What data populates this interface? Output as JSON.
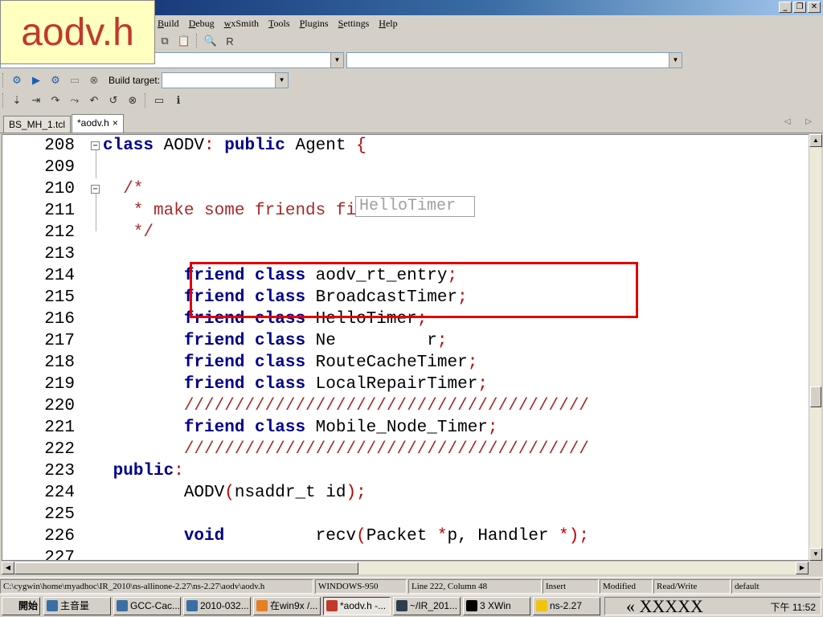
{
  "overlay": {
    "filename_label": "aodv.h"
  },
  "window": {
    "min_glyph": "_",
    "restore_glyph": "❐",
    "close_glyph": "✕"
  },
  "menu": [
    {
      "label": "Build",
      "accel": "B"
    },
    {
      "label": "Debug",
      "accel": "D"
    },
    {
      "label": "wxSmith",
      "accel": "w"
    },
    {
      "label": "Tools",
      "accel": "T"
    },
    {
      "label": "Plugins",
      "accel": "P"
    },
    {
      "label": "Settings",
      "accel": "S"
    },
    {
      "label": "Help",
      "accel": "H"
    }
  ],
  "toolbar": {
    "build_target_label": "Build target:"
  },
  "tabs": [
    {
      "label": "BS_MH_1.tcl",
      "active": false
    },
    {
      "label": "*aodv.h",
      "active": true,
      "close": "×"
    }
  ],
  "tab_nav": "◁ ▷",
  "code": [
    {
      "n": "208",
      "tokens": [
        [
          "kw",
          "class"
        ],
        [
          "id",
          " AODV"
        ],
        [
          "op",
          ":"
        ],
        [
          "id",
          " "
        ],
        [
          "kw",
          "public"
        ],
        [
          "id",
          " Agent "
        ],
        [
          "op",
          "{"
        ]
      ]
    },
    {
      "n": "209",
      "tokens": []
    },
    {
      "n": "210",
      "tokens": [
        [
          "cm",
          "  /*"
        ]
      ]
    },
    {
      "n": "211",
      "tokens": [
        [
          "cm",
          "   * make some friends first"
        ]
      ]
    },
    {
      "n": "212",
      "tokens": [
        [
          "cm",
          "   */"
        ]
      ]
    },
    {
      "n": "213",
      "tokens": []
    },
    {
      "n": "214",
      "tokens": [
        [
          "id",
          "        "
        ],
        [
          "kw",
          "friend class"
        ],
        [
          "id",
          " aodv_rt_entry"
        ],
        [
          "op",
          ";"
        ]
      ]
    },
    {
      "n": "215",
      "tokens": [
        [
          "id",
          "        "
        ],
        [
          "kw",
          "friend class"
        ],
        [
          "id",
          " BroadcastTimer"
        ],
        [
          "op",
          ";"
        ]
      ]
    },
    {
      "n": "216",
      "tokens": [
        [
          "id",
          "        "
        ],
        [
          "kw",
          "friend class"
        ],
        [
          "id",
          " HelloTimer"
        ],
        [
          "op",
          ";"
        ]
      ]
    },
    {
      "n": "217",
      "tokens": [
        [
          "id",
          "        "
        ],
        [
          "kw",
          "friend class"
        ],
        [
          "id",
          " Ne         r"
        ],
        [
          "op",
          ";"
        ]
      ]
    },
    {
      "n": "218",
      "tokens": [
        [
          "id",
          "        "
        ],
        [
          "kw",
          "friend class"
        ],
        [
          "id",
          " RouteCacheTimer"
        ],
        [
          "op",
          ";"
        ]
      ]
    },
    {
      "n": "219",
      "tokens": [
        [
          "id",
          "        "
        ],
        [
          "kw",
          "friend class"
        ],
        [
          "id",
          " LocalRepairTimer"
        ],
        [
          "op",
          ";"
        ]
      ]
    },
    {
      "n": "220",
      "tokens": [
        [
          "id",
          "        "
        ],
        [
          "cm",
          "////////////////////////////////////////"
        ]
      ]
    },
    {
      "n": "221",
      "tokens": [
        [
          "id",
          "        "
        ],
        [
          "kw",
          "friend class"
        ],
        [
          "id",
          " Mobile_Node_Timer"
        ],
        [
          "op",
          ";"
        ]
      ]
    },
    {
      "n": "222",
      "tokens": [
        [
          "id",
          "        "
        ],
        [
          "cm",
          "////////////////////////////////////////"
        ]
      ]
    },
    {
      "n": "223",
      "tokens": [
        [
          "id",
          " "
        ],
        [
          "kw",
          "public"
        ],
        [
          "op",
          ":"
        ]
      ]
    },
    {
      "n": "224",
      "tokens": [
        [
          "id",
          "        AODV"
        ],
        [
          "op",
          "("
        ],
        [
          "id",
          "nsaddr_t id"
        ],
        [
          "op",
          ");"
        ]
      ]
    },
    {
      "n": "225",
      "tokens": []
    },
    {
      "n": "226",
      "tokens": [
        [
          "id",
          "        "
        ],
        [
          "kw",
          "void"
        ],
        [
          "id",
          "         recv"
        ],
        [
          "op",
          "("
        ],
        [
          "id",
          "Packet "
        ],
        [
          "op",
          "*"
        ],
        [
          "id",
          "p, Handler "
        ],
        [
          "op",
          "*"
        ],
        [
          "op",
          ");"
        ]
      ]
    },
    {
      "n": "227",
      "tokens": []
    }
  ],
  "tooltip": "HelloTimer",
  "status": {
    "path": "C:\\cygwin\\home\\myadhoc\\IR_2010\\ns-allinone-2.27\\ns-2.27\\aodv\\aodv.h",
    "encoding": "WINDOWS-950",
    "position": "Line 222, Column 48",
    "mode": "Insert",
    "modified": "Modified",
    "access": "Read/Write",
    "lang": "default"
  },
  "taskbar": {
    "start": "開始",
    "items": [
      "主音量",
      "GCC-Cac...",
      "2010-032...",
      "在win9x /...",
      "*aodv.h -...",
      "~/IR_201...",
      "3 XWin",
      "ns-2.27"
    ],
    "tray_text": "« XXXXX",
    "clock": "下午 11:52"
  },
  "colors": {
    "keyword": "#00008b",
    "comment": "#a52a2a",
    "operator": "#c00000",
    "highlight": "#e00000"
  }
}
